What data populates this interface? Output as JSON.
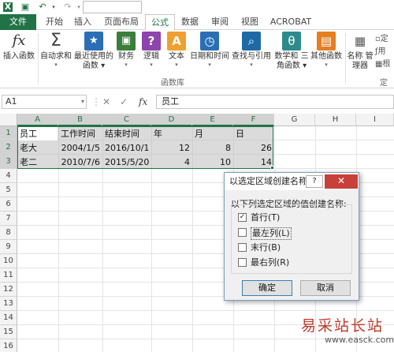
{
  "qat": {
    "save_icon": "save-icon",
    "undo_icon": "undo-icon",
    "redo_icon": "redo-icon"
  },
  "tabs": [
    {
      "label": "文件"
    },
    {
      "label": "开始"
    },
    {
      "label": "插入"
    },
    {
      "label": "页面布局"
    },
    {
      "label": "公式"
    },
    {
      "label": "数据"
    },
    {
      "label": "审阅"
    },
    {
      "label": "视图"
    },
    {
      "label": "ACROBAT"
    }
  ],
  "ribbon": {
    "buttons": [
      {
        "label": "插入函数",
        "icon": "fx",
        "label2": ""
      },
      {
        "label": "自动求和",
        "icon": "Σ",
        "label2": ""
      },
      {
        "label": "最近使用的",
        "icon": "★",
        "label2": "函数"
      },
      {
        "label": "财务",
        "icon": "▣",
        "label2": ""
      },
      {
        "label": "逻辑",
        "icon": "?",
        "label2": ""
      },
      {
        "label": "文本",
        "icon": "A",
        "label2": ""
      },
      {
        "label": "日期和时间",
        "icon": "◷",
        "label2": ""
      },
      {
        "label": "查找与引用",
        "icon": "⌕",
        "label2": ""
      },
      {
        "label": "数学和",
        "icon": "θ",
        "label2": "三角函数"
      },
      {
        "label": "其他函数",
        "icon": "▤",
        "label2": ""
      },
      {
        "label": "名称",
        "icon": "▦",
        "label2": "管理器"
      }
    ],
    "group_label": "函数库",
    "right_items": [
      "定",
      "用",
      "根"
    ],
    "right_group": "定义"
  },
  "formula_bar": {
    "name_box": "A1",
    "fx": "fx",
    "cancel": "✕",
    "enter": "✓",
    "value": "员工"
  },
  "columns": [
    "A",
    "B",
    "C",
    "D",
    "E",
    "F",
    "G",
    "H",
    "I"
  ],
  "rows": [
    "1",
    "2",
    "3",
    "4",
    "5",
    "6",
    "7",
    "8",
    "9",
    "10",
    "11",
    "12",
    "13",
    "14",
    "15",
    "16"
  ],
  "cells": {
    "r1": [
      "员工",
      "工作时间",
      "结束时间",
      "年",
      "月",
      "日"
    ],
    "r2": [
      "老大",
      "2004/1/5",
      "2016/10/1",
      "12",
      "8",
      "26"
    ],
    "r3": [
      "老二",
      "2010/7/6",
      "2015/5/20",
      "4",
      "10",
      "14"
    ]
  },
  "dialog": {
    "title": "以选定区域创建名称",
    "help": "?",
    "close": "✕",
    "prompt": "以下列选定区域的值创建名称:",
    "options": [
      {
        "label": "首行(T)",
        "checked": true
      },
      {
        "label": "最左列(L)",
        "checked": false
      },
      {
        "label": "末行(B)",
        "checked": false
      },
      {
        "label": "最右列(R)",
        "checked": false
      }
    ],
    "ok": "确定",
    "cancel": "取消"
  },
  "watermark": {
    "text": "易采站长站",
    "url": "www.easck.com"
  },
  "colors": {
    "accent": "#217346",
    "close": "#c7413a"
  }
}
